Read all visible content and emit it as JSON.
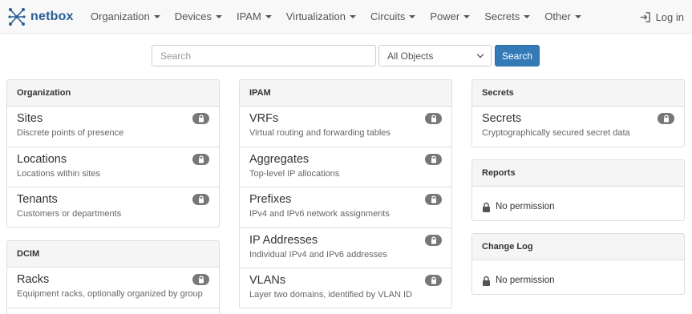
{
  "brand": {
    "name": "netbox"
  },
  "nav": {
    "items": [
      {
        "label": "Organization"
      },
      {
        "label": "Devices"
      },
      {
        "label": "IPAM"
      },
      {
        "label": "Virtualization"
      },
      {
        "label": "Circuits"
      },
      {
        "label": "Power"
      },
      {
        "label": "Secrets"
      },
      {
        "label": "Other"
      }
    ],
    "login_label": "Log in"
  },
  "search": {
    "placeholder": "Search",
    "value": "",
    "scope_selected": "All Objects",
    "button_label": "Search"
  },
  "colors": {
    "brand": "#2a5f95",
    "primary_button": "#337ab7",
    "badge": "#777777"
  },
  "panels": {
    "organization": {
      "title": "Organization",
      "items": [
        {
          "title": "Sites",
          "desc": "Discrete points of presence",
          "icon": "lock-icon"
        },
        {
          "title": "Locations",
          "desc": "Locations within sites",
          "icon": "lock-icon"
        },
        {
          "title": "Tenants",
          "desc": "Customers or departments",
          "icon": "lock-icon"
        }
      ]
    },
    "dcim": {
      "title": "DCIM",
      "items": [
        {
          "title": "Racks",
          "desc": "Equipment racks, optionally organized by group",
          "icon": "lock-icon"
        }
      ]
    },
    "ipam": {
      "title": "IPAM",
      "items": [
        {
          "title": "VRFs",
          "desc": "Virtual routing and forwarding tables",
          "icon": "lock-icon"
        },
        {
          "title": "Aggregates",
          "desc": "Top-level IP allocations",
          "icon": "lock-icon"
        },
        {
          "title": "Prefixes",
          "desc": "IPv4 and IPv6 network assignments",
          "icon": "lock-icon"
        },
        {
          "title": "IP Addresses",
          "desc": "Individual IPv4 and IPv6 addresses",
          "icon": "lock-icon"
        },
        {
          "title": "VLANs",
          "desc": "Layer two domains, identified by VLAN ID",
          "icon": "lock-icon"
        }
      ]
    },
    "secrets": {
      "title": "Secrets",
      "items": [
        {
          "title": "Secrets",
          "desc": "Cryptographically secured secret data",
          "icon": "lock-icon"
        }
      ]
    },
    "reports": {
      "title": "Reports",
      "message": "No permission"
    },
    "changelog": {
      "title": "Change Log",
      "message": "No permission"
    }
  }
}
